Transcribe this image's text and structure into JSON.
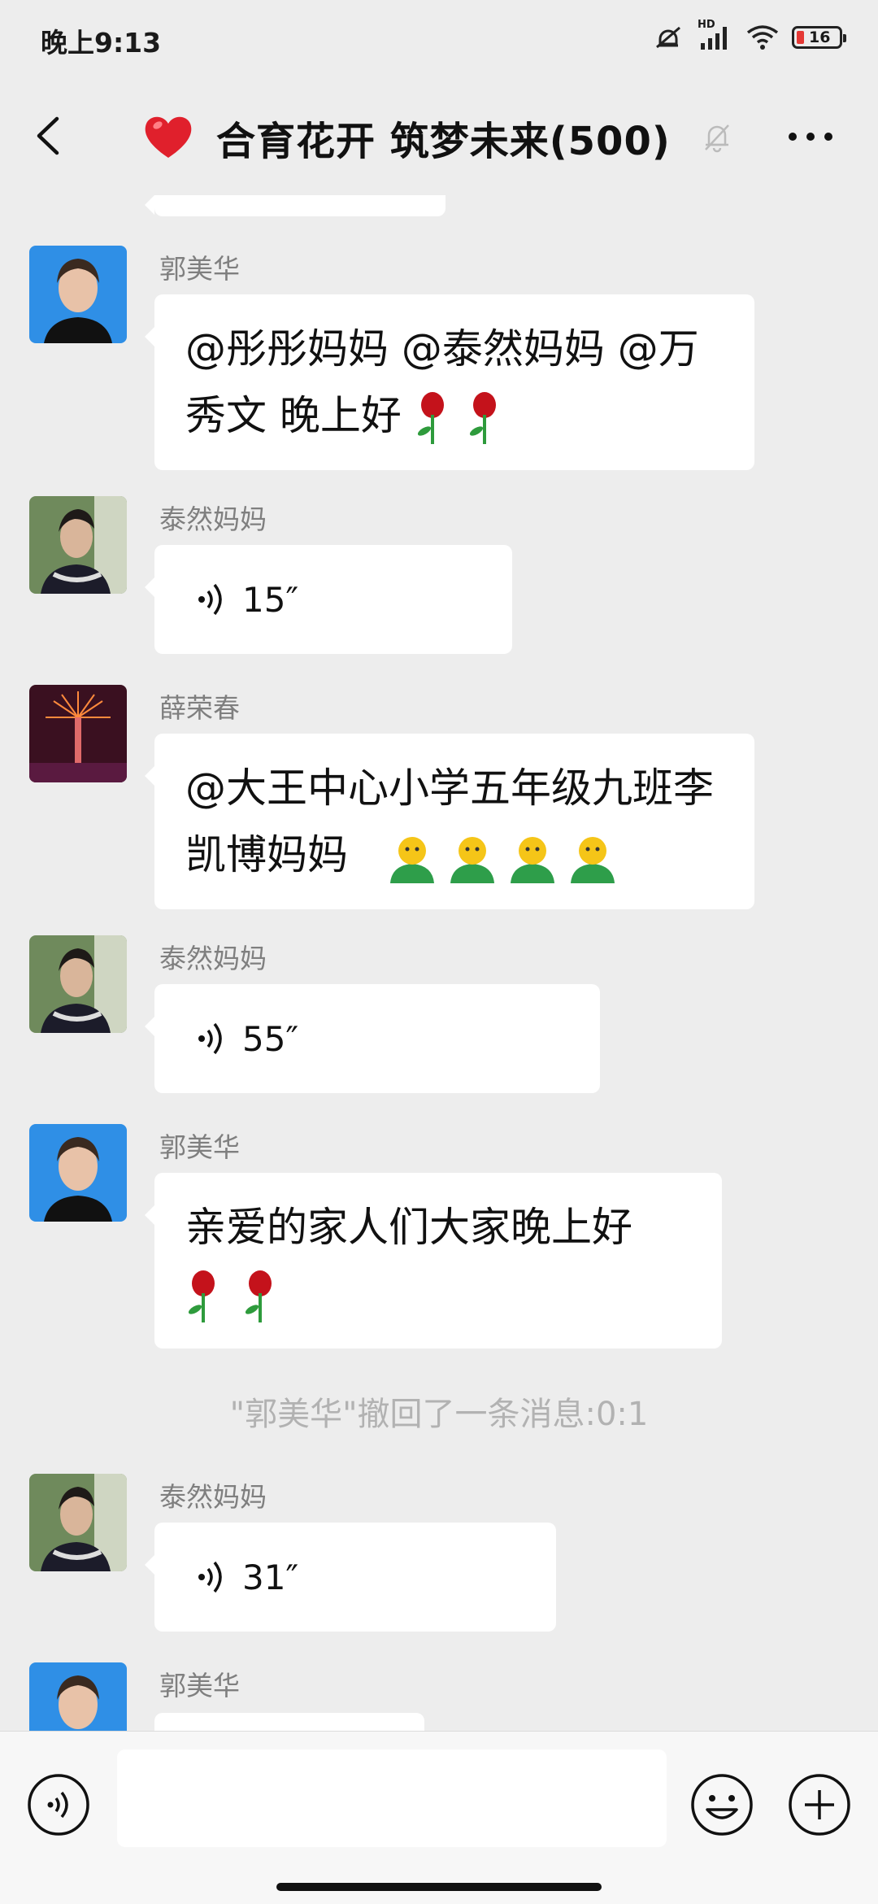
{
  "status": {
    "time": "晚上9:13",
    "battery": "16",
    "network_label": "HD"
  },
  "nav": {
    "title": "合育花开 筑梦未来(500)"
  },
  "messages": [
    {
      "sender": "郭美华",
      "text": "@彤彤妈妈 @泰然妈妈 @万秀文 晚上好"
    },
    {
      "sender": "泰然妈妈",
      "duration": "15″"
    },
    {
      "sender": "薛荣春",
      "text": "@大王中心小学五年级九班李凯博妈妈"
    },
    {
      "sender": "泰然妈妈",
      "duration": "55″"
    },
    {
      "sender": "郭美华",
      "text": "亲爱的家人们大家晚上好"
    },
    {
      "system": "\"郭美华\"撤回了一条消息:0:1"
    },
    {
      "sender": "泰然妈妈",
      "duration": "31″"
    },
    {
      "sender": "郭美华"
    }
  ],
  "input": {
    "placeholder": ""
  },
  "icons": {
    "back": "chevron-left-icon",
    "heart": "heart-icon",
    "mute": "bell-off-icon",
    "more": "more-icon",
    "voice": "voice-input-icon",
    "emoji": "emoji-icon",
    "plus": "plus-icon"
  },
  "colors": {
    "background": "#ededed",
    "bubble": "#ffffff",
    "sender": "#7f7f7f",
    "system": "#b2b2b2",
    "battery_low": "#e53935"
  }
}
